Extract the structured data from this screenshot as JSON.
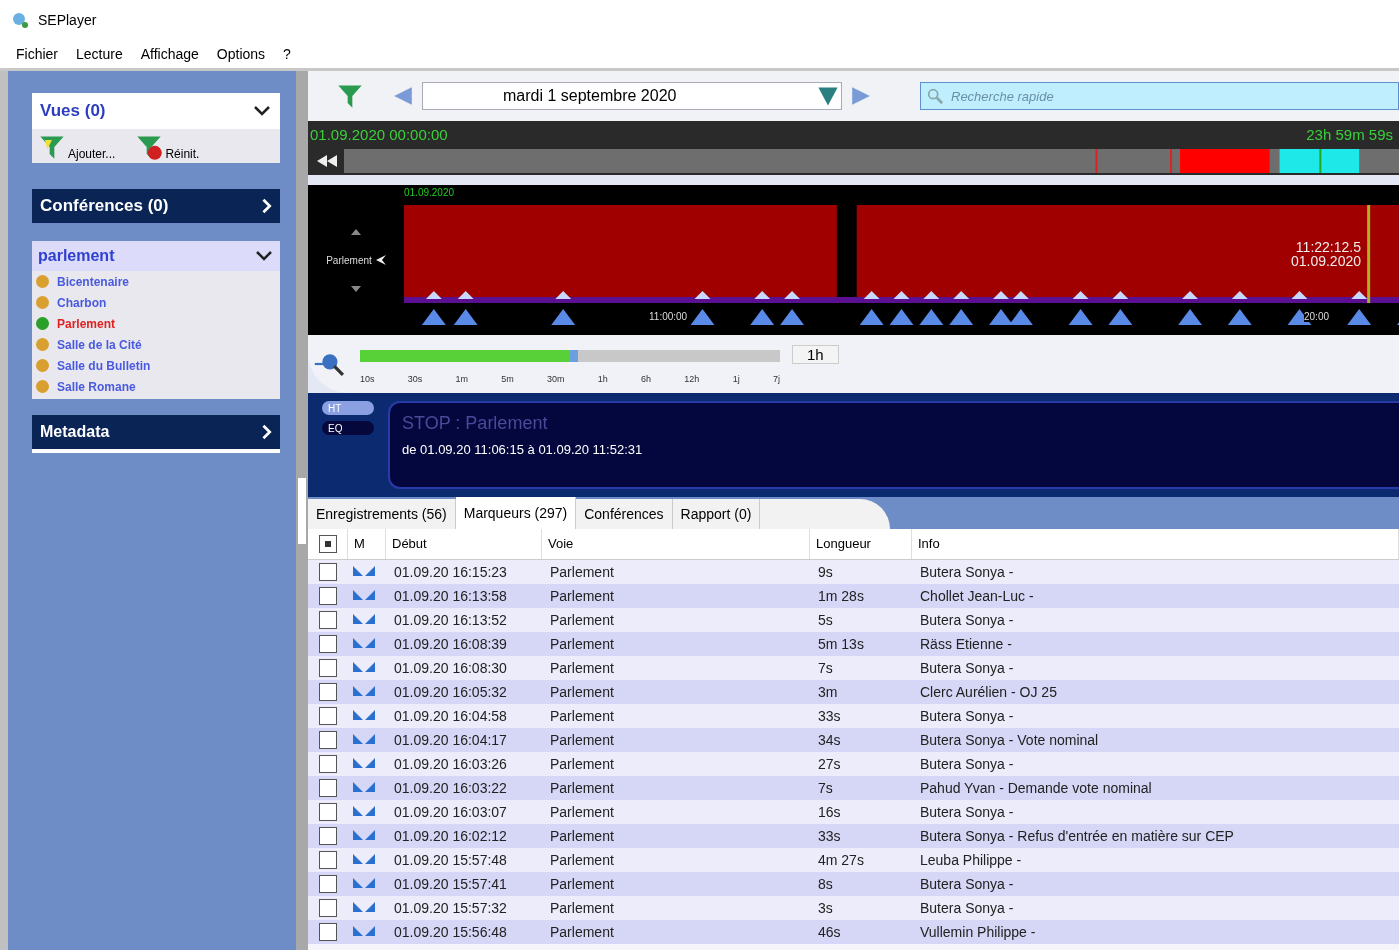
{
  "window": {
    "title": "SEPlayer"
  },
  "menu": [
    "Fichier",
    "Lecture",
    "Affichage",
    "Options",
    "?"
  ],
  "sidebar": {
    "views": {
      "title": "Vues (0)",
      "expanded": true,
      "actions": [
        "Ajouter...",
        "Réinit."
      ]
    },
    "conferences": {
      "title": "Conférences (0)",
      "expanded": false
    },
    "rooms": {
      "title": "parlement",
      "expanded": true,
      "items": [
        {
          "label": "Bicentenaire",
          "color": "#d9a030",
          "selected": false
        },
        {
          "label": "Charbon",
          "color": "#d9a030",
          "selected": false
        },
        {
          "label": "Parlement",
          "color": "#2aa02a",
          "selected": true
        },
        {
          "label": "Salle de la Cité",
          "color": "#d9a030",
          "selected": false
        },
        {
          "label": "Salle du Bulletin",
          "color": "#d9a030",
          "selected": false
        },
        {
          "label": "Salle Romane",
          "color": "#d9a030",
          "selected": false
        }
      ]
    },
    "metadata": {
      "title": "Metadata",
      "expanded": false
    }
  },
  "toolbar": {
    "date": "mardi 1 septembre 2020",
    "search": {
      "placeholder": "Recherche rapide"
    }
  },
  "timeline": {
    "start": "01.09.2020 00:00:00",
    "duration": "23h 59m 59s",
    "day": "01.09.2020",
    "track": "Parlement",
    "cursor_time": "11:22:12.5",
    "cursor_date": "01.09.2020",
    "ticks": [
      "11:00:00",
      "20:00"
    ]
  },
  "zoom": {
    "level": 0.52,
    "reading": "1h",
    "scale": [
      "10s",
      "30s",
      "1m",
      "5m",
      "30m",
      "1h",
      "6h",
      "12h",
      "1j",
      "7j"
    ]
  },
  "modes": [
    {
      "label": "HT",
      "selected": true
    },
    {
      "label": "EQ",
      "selected": false
    }
  ],
  "info": {
    "status": "STOP : Parlement",
    "range": "de 01.09.20 11:06:15 à 01.09.20 11:52:31"
  },
  "tabs": [
    {
      "label": "Enregistrements (56)",
      "selected": false
    },
    {
      "label": "Marqueurs (297)",
      "selected": true
    },
    {
      "label": "Conférences",
      "selected": false
    },
    {
      "label": "Rapport (0)",
      "selected": false
    }
  ],
  "table": {
    "select_all": {
      "checked": true
    },
    "columns": [
      "M",
      "Début",
      "Voie",
      "Longueur",
      "Info"
    ],
    "rows": [
      {
        "checked": false,
        "start": "01.09.20 16:15:23",
        "channel": "Parlement",
        "length": "9s",
        "info": "Butera Sonya -"
      },
      {
        "checked": false,
        "start": "01.09.20 16:13:58",
        "channel": "Parlement",
        "length": "1m 28s",
        "info": "Chollet Jean-Luc -"
      },
      {
        "checked": false,
        "start": "01.09.20 16:13:52",
        "channel": "Parlement",
        "length": "5s",
        "info": "Butera Sonya -"
      },
      {
        "checked": false,
        "start": "01.09.20 16:08:39",
        "channel": "Parlement",
        "length": "5m 13s",
        "info": "Räss Etienne -"
      },
      {
        "checked": false,
        "start": "01.09.20 16:08:30",
        "channel": "Parlement",
        "length": "7s",
        "info": "Butera Sonya -"
      },
      {
        "checked": false,
        "start": "01.09.20 16:05:32",
        "channel": "Parlement",
        "length": "3m",
        "info": "Clerc Aurélien - OJ 25"
      },
      {
        "checked": false,
        "start": "01.09.20 16:04:58",
        "channel": "Parlement",
        "length": "33s",
        "info": "Butera Sonya -"
      },
      {
        "checked": false,
        "start": "01.09.20 16:04:17",
        "channel": "Parlement",
        "length": "34s",
        "info": "Butera Sonya - Vote nominal"
      },
      {
        "checked": false,
        "start": "01.09.20 16:03:26",
        "channel": "Parlement",
        "length": "27s",
        "info": "Butera Sonya -"
      },
      {
        "checked": false,
        "start": "01.09.20 16:03:22",
        "channel": "Parlement",
        "length": "7s",
        "info": "Pahud Yvan - Demande vote nominal"
      },
      {
        "checked": false,
        "start": "01.09.20 16:03:07",
        "channel": "Parlement",
        "length": "16s",
        "info": "Butera Sonya -"
      },
      {
        "checked": false,
        "start": "01.09.20 16:02:12",
        "channel": "Parlement",
        "length": "33s",
        "info": "Butera Sonya - Refus d'entrée en matière sur CEP"
      },
      {
        "checked": false,
        "start": "01.09.20 15:57:48",
        "channel": "Parlement",
        "length": "4m 27s",
        "info": "Leuba Philippe -"
      },
      {
        "checked": false,
        "start": "01.09.20 15:57:41",
        "channel": "Parlement",
        "length": "8s",
        "info": "Butera Sonya -"
      },
      {
        "checked": false,
        "start": "01.09.20 15:57:32",
        "channel": "Parlement",
        "length": "3s",
        "info": "Butera Sonya -"
      },
      {
        "checked": false,
        "start": "01.09.20 15:56:48",
        "channel": "Parlement",
        "length": "46s",
        "info": "Vullemin Philippe -"
      }
    ]
  }
}
